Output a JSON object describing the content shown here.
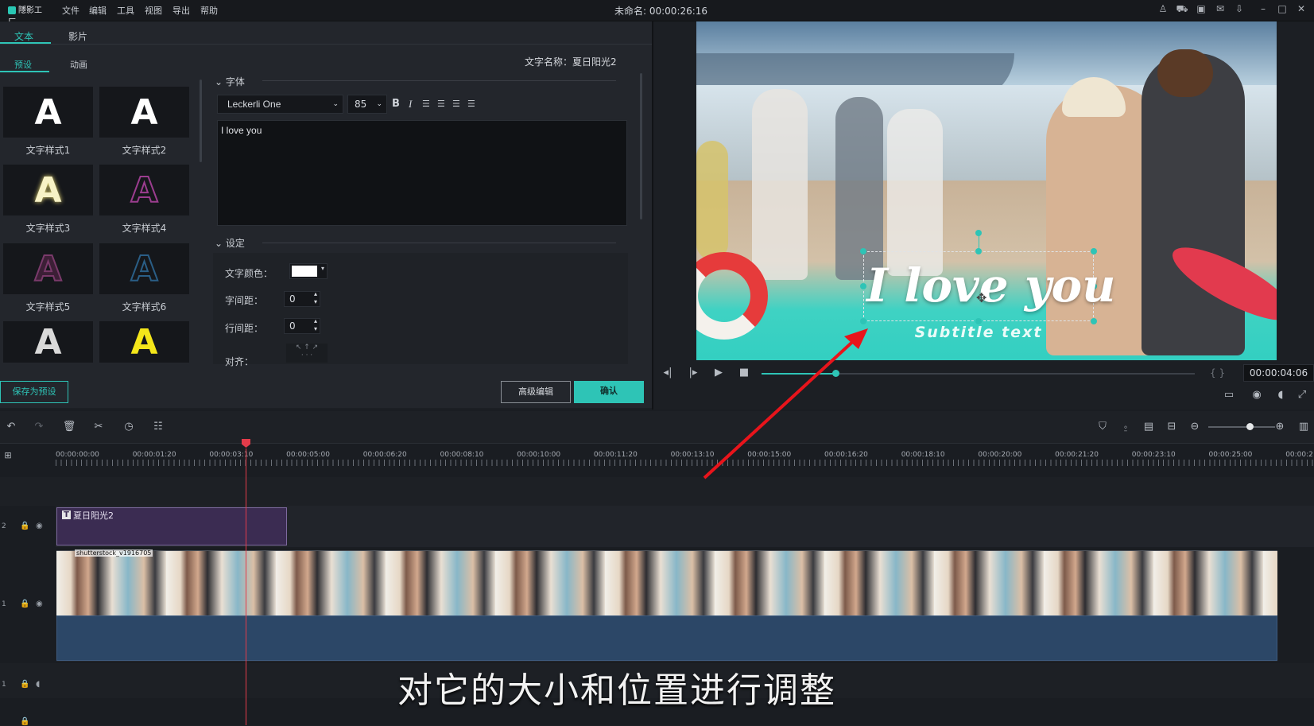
{
  "app": {
    "logo_text": "隱影工厂",
    "menu": [
      "文件",
      "编辑",
      "工具",
      "视图",
      "导出",
      "帮助"
    ],
    "title": "未命名: 00:00:26:16",
    "top_icons": [
      "user-icon",
      "cart-icon",
      "save-icon",
      "mail-icon",
      "download-icon",
      "minimize-icon",
      "maximize-icon",
      "close-icon"
    ]
  },
  "left_panel": {
    "main_tabs": [
      "文本",
      "影片"
    ],
    "sub_tabs": [
      "预设",
      "动画"
    ],
    "text_name_label": "文字名称：夏日阳光2",
    "presets": [
      {
        "label": "文字样式1",
        "glyph": "A",
        "color": "#ffffff"
      },
      {
        "label": "文字样式2",
        "glyph": "A",
        "color": "#ffffff"
      },
      {
        "label": "文字样式3",
        "glyph": "A",
        "color": "#f7f2c6"
      },
      {
        "label": "文字样式4",
        "glyph": "A",
        "color": "#9b3d8f"
      },
      {
        "label": "文字样式5",
        "glyph": "A",
        "color": "#7a3a6b"
      },
      {
        "label": "文字样式6",
        "glyph": "A",
        "color": "#2a5e86"
      },
      {
        "label": "",
        "glyph": "A",
        "color": "#d9d9d9"
      },
      {
        "label": "",
        "glyph": "A",
        "color": "#f4e61a"
      }
    ],
    "font_section_title": "字体",
    "font_family": "Leckerli One",
    "font_size": "85",
    "text_content": "I love you",
    "settings_title": "设定",
    "text_color_label": "文字颜色：",
    "text_color_value": "#ffffff",
    "letter_spacing_label": "字间距：",
    "letter_spacing": "0",
    "line_spacing_label": "行间距：",
    "line_spacing": "0",
    "align_label": "对齐：",
    "save_preset_button": "保存为预设",
    "advanced_edit_button": "高级编辑",
    "confirm_button": "确认"
  },
  "preview": {
    "title_text": "I love you",
    "subtitle_text": "Subtitle text",
    "timecode": "00:00:04:06",
    "progress": 0.17
  },
  "timeline": {
    "ruler_labels": [
      "00:00:00:00",
      "00:00:01:20",
      "00:00:03:10",
      "00:00:05:00",
      "00:00:06:20",
      "00:00:08:10",
      "00:00:10:00",
      "00:00:11:20",
      "00:00:13:10",
      "00:00:15:00",
      "00:00:16:20",
      "00:00:18:10",
      "00:00:20:00",
      "00:00:21:20",
      "00:00:23:10",
      "00:00:25:00",
      "00:00:2"
    ],
    "text_clip_label": "夏日阳光2",
    "video_clip_label": "shutterstock_v1916705",
    "track_labels": [
      "2",
      "1",
      "1"
    ]
  },
  "caption": "对它的大小和位置进行调整",
  "colors": {
    "accent": "#2ec4b6",
    "text_clip": "#3b2c52",
    "audio_clip": "#2c4767",
    "playhead": "#e33b4a",
    "arrow": "#e8141b"
  }
}
